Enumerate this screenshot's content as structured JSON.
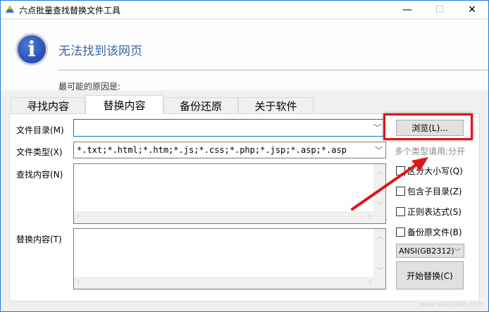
{
  "window": {
    "title": "六点批量查找替换文件工具",
    "minimize": "—",
    "maximize": "☐",
    "close": "✕"
  },
  "header": {
    "title": "无法找到该网页",
    "reason": "最可能的原因是:"
  },
  "tabs": [
    {
      "label": "寻找内容"
    },
    {
      "label": "替换内容"
    },
    {
      "label": "备份还原"
    },
    {
      "label": "关于软件"
    }
  ],
  "form": {
    "dir_label": "文件目录(M)",
    "dir_value": "",
    "type_label": "文件类型(X)",
    "type_value": "*.txt;*.html;*.htm;*.js;*.css;*.php;*.jsp;*.asp;*.asp",
    "find_label": "查找内容(N)",
    "replace_label": "替换内容(T)",
    "browse": "浏览(L)...",
    "hint": "多个类型请用;分开",
    "checkboxes": [
      {
        "label": "区分大小写(Q)",
        "checked": false
      },
      {
        "label": "包含子目录(Z)",
        "checked": false
      },
      {
        "label": "正则表达式(S)",
        "checked": false
      },
      {
        "label": "备份原文件(B)",
        "checked": false
      }
    ],
    "encoding": "ANSI(GB2312)",
    "start": "开始替换(C)"
  },
  "watermark": "www.xiazaiba.com",
  "colors": {
    "accent": "#1e7bd6",
    "highlight": "#e0141b"
  }
}
